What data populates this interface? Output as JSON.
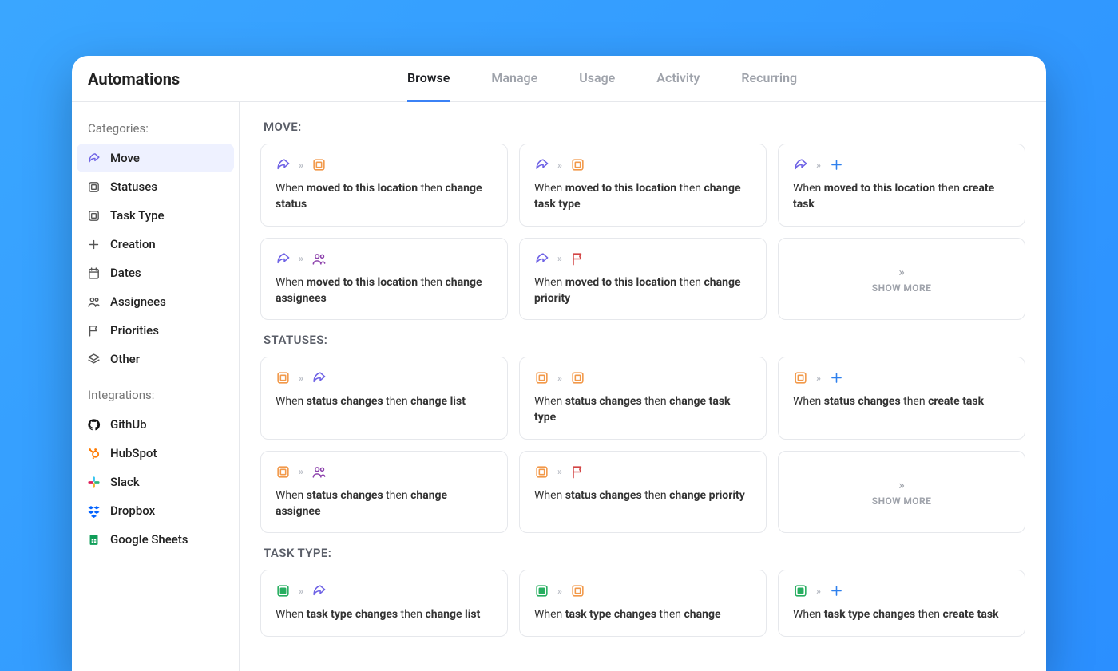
{
  "header": {
    "title": "Automations",
    "tabs": [
      {
        "label": "Browse",
        "active": true
      },
      {
        "label": "Manage",
        "active": false
      },
      {
        "label": "Usage",
        "active": false
      },
      {
        "label": "Activity",
        "active": false
      },
      {
        "label": "Recurring",
        "active": false
      }
    ]
  },
  "sidebar": {
    "categories_label": "Categories:",
    "categories": [
      {
        "label": "Move",
        "icon": "arrow-share",
        "active": true
      },
      {
        "label": "Statuses",
        "icon": "status-square",
        "active": false
      },
      {
        "label": "Task Type",
        "icon": "status-square",
        "active": false
      },
      {
        "label": "Creation",
        "icon": "plus",
        "active": false
      },
      {
        "label": "Dates",
        "icon": "calendar",
        "active": false
      },
      {
        "label": "Assignees",
        "icon": "people",
        "active": false
      },
      {
        "label": "Priorities",
        "icon": "flag",
        "active": false
      },
      {
        "label": "Other",
        "icon": "stack",
        "active": false
      }
    ],
    "integrations_label": "Integrations:",
    "integrations": [
      {
        "label": "GithUb",
        "icon": "github"
      },
      {
        "label": "HubSpot",
        "icon": "hubspot"
      },
      {
        "label": "Slack",
        "icon": "slack"
      },
      {
        "label": "Dropbox",
        "icon": "dropbox"
      },
      {
        "label": "Google Sheets",
        "icon": "gsheets"
      }
    ]
  },
  "sections": [
    {
      "title": "MOVE:",
      "cards": [
        {
          "icons": [
            "arrow-share",
            "status-square-orange"
          ],
          "text_prefix": "When ",
          "bold1": "moved to this location",
          "mid": " then ",
          "bold2": "change status"
        },
        {
          "icons": [
            "arrow-share",
            "status-square-orange"
          ],
          "text_prefix": "When ",
          "bold1": "moved to this location",
          "mid": " then ",
          "bold2": "change task type"
        },
        {
          "icons": [
            "arrow-share",
            "plus-blue"
          ],
          "text_prefix": "When ",
          "bold1": "moved to this location",
          "mid": " then ",
          "bold2": "create task"
        },
        {
          "icons": [
            "arrow-share",
            "people-purple"
          ],
          "text_prefix": "When ",
          "bold1": "moved to this location",
          "mid": " then ",
          "bold2": "change assignees"
        },
        {
          "icons": [
            "arrow-share",
            "flag-red"
          ],
          "text_prefix": "When ",
          "bold1": "moved to this location",
          "mid": " then ",
          "bold2": "change priority"
        }
      ],
      "show_more": "SHOW MORE"
    },
    {
      "title": "STATUSES:",
      "cards": [
        {
          "icons": [
            "status-square-orange",
            "arrow-share"
          ],
          "text_prefix": "When ",
          "bold1": "status changes",
          "mid": " then ",
          "bold2": "change list"
        },
        {
          "icons": [
            "status-square-orange",
            "status-square-orange"
          ],
          "text_prefix": "When ",
          "bold1": "status changes",
          "mid": " then ",
          "bold2": "change task type"
        },
        {
          "icons": [
            "status-square-orange",
            "plus-blue"
          ],
          "text_prefix": "When ",
          "bold1": "status changes",
          "mid": " then ",
          "bold2": "create task"
        },
        {
          "icons": [
            "status-square-orange",
            "people-purple"
          ],
          "text_prefix": "When ",
          "bold1": "status changes",
          "mid": " then ",
          "bold2": "change assignee"
        },
        {
          "icons": [
            "status-square-orange",
            "flag-red"
          ],
          "text_prefix": "When ",
          "bold1": "status changes",
          "mid": " then ",
          "bold2": "change priority"
        }
      ],
      "show_more": "SHOW MORE"
    },
    {
      "title": "TASK TYPE:",
      "cards": [
        {
          "icons": [
            "status-square-green",
            "arrow-share"
          ],
          "text_prefix": "When ",
          "bold1": "task type changes",
          "mid": " then ",
          "bold2": "change list"
        },
        {
          "icons": [
            "status-square-green",
            "status-square-orange"
          ],
          "text_prefix": "When ",
          "bold1": "task type changes",
          "mid": " then ",
          "bold2": "change"
        },
        {
          "icons": [
            "status-square-green",
            "plus-blue"
          ],
          "text_prefix": "When ",
          "bold1": "task type changes",
          "mid": " then ",
          "bold2": "create task"
        }
      ],
      "show_more": null
    }
  ],
  "colors": {
    "purple": "#6E62E5",
    "orange": "#F2994A",
    "green": "#27AE60",
    "red": "#D34545",
    "blue": "#2F80ED"
  }
}
